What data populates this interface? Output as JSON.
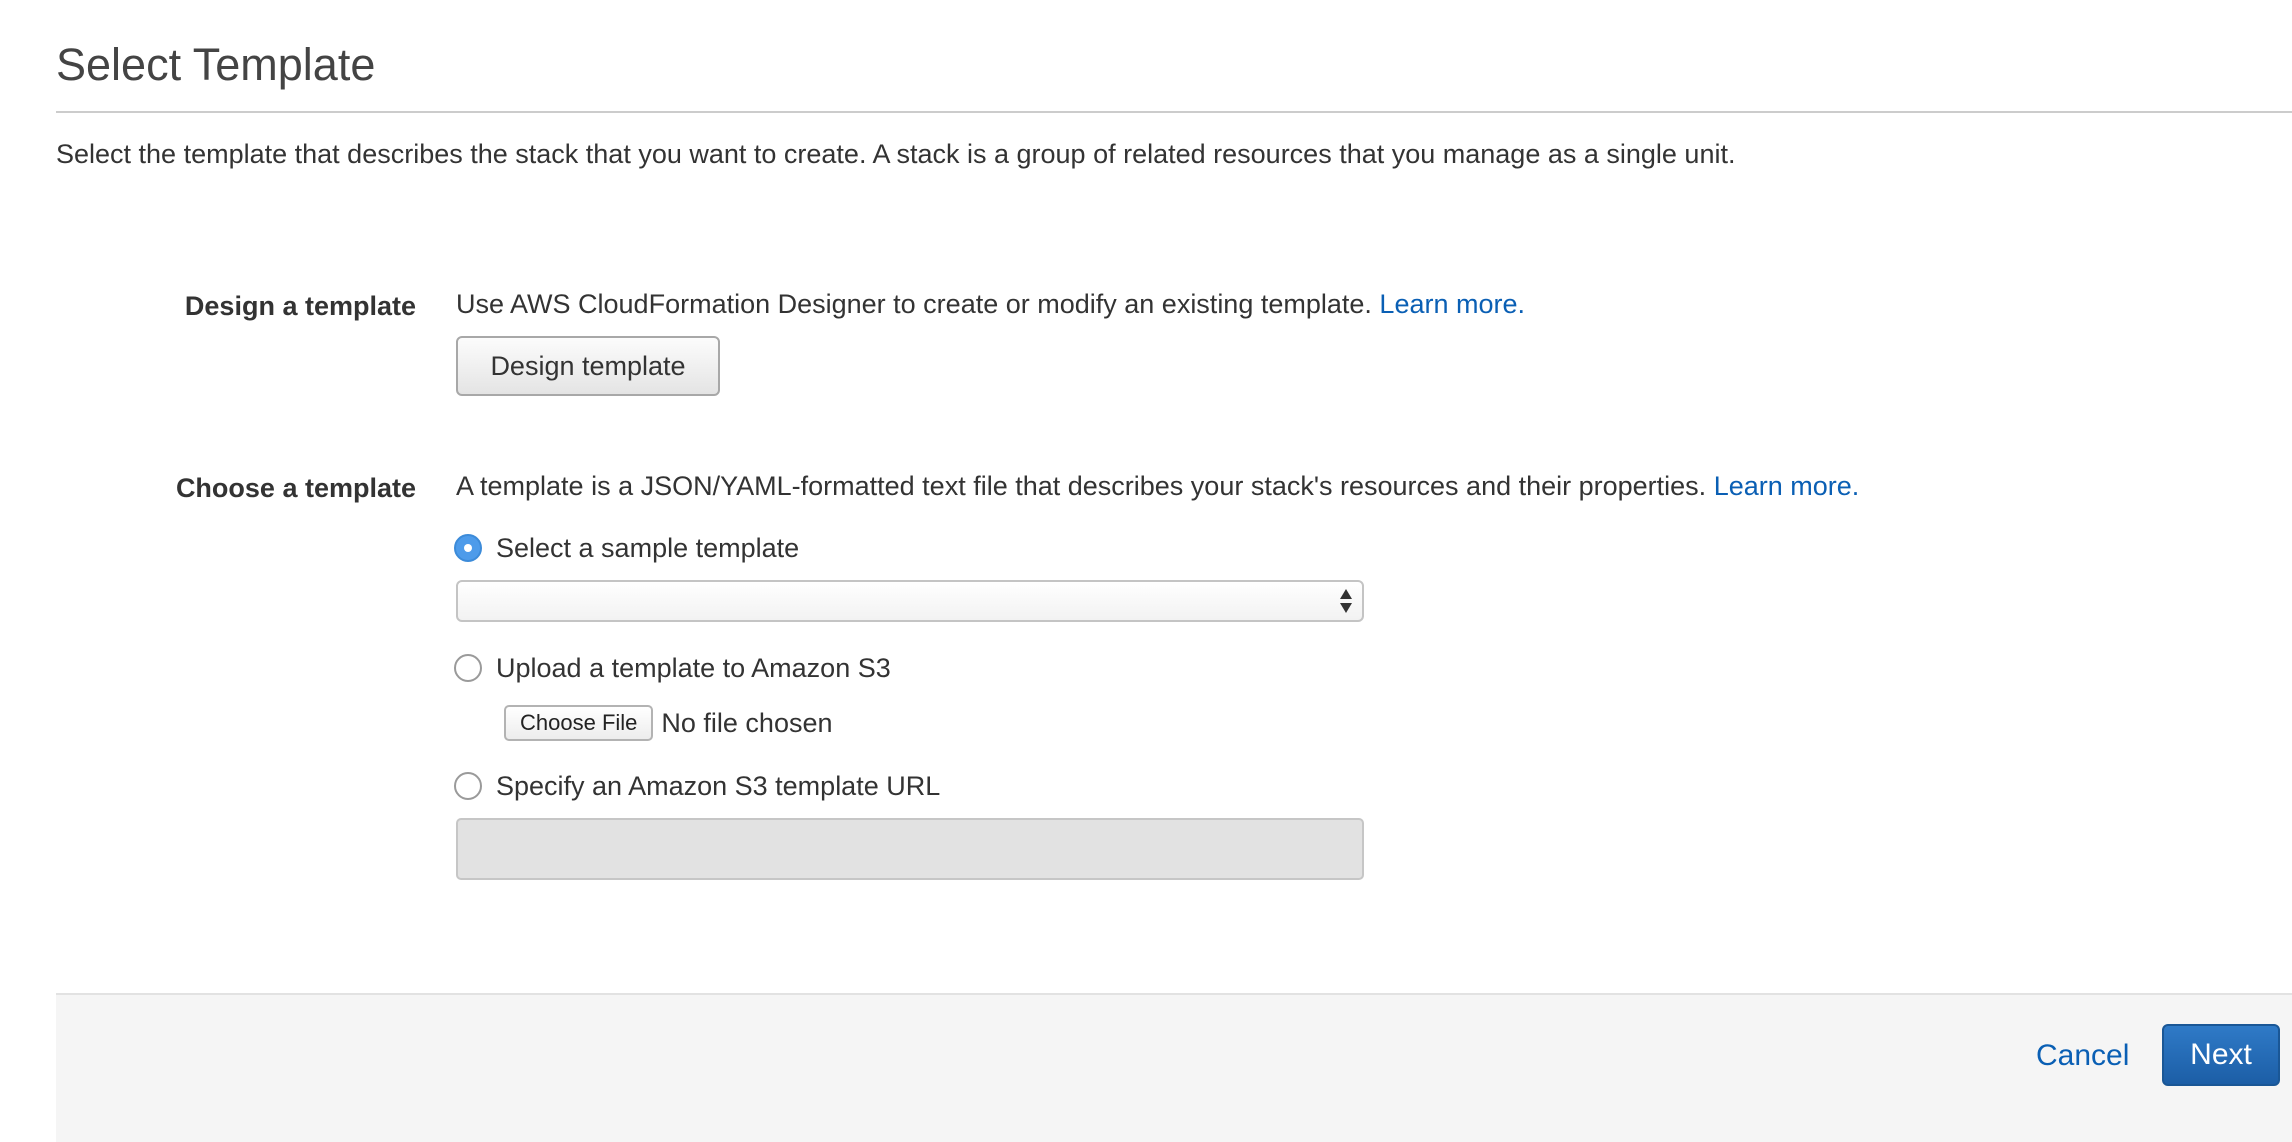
{
  "page": {
    "title": "Select Template",
    "intro": "Select the template that describes the stack that you want to create. A stack is a group of related resources that you manage as a single unit."
  },
  "design_section": {
    "label": "Design a template",
    "description": "Use AWS CloudFormation Designer to create or modify an existing template.",
    "learn_more": "Learn more.",
    "button_label": "Design template"
  },
  "choose_section": {
    "label": "Choose a template",
    "description": "A template is a JSON/YAML-formatted text file that describes your stack's resources and their properties.",
    "learn_more": "Learn more.",
    "options": [
      {
        "label": "Select a sample template",
        "checked": true
      },
      {
        "label": "Upload a template to Amazon S3",
        "checked": false
      },
      {
        "label": "Specify an Amazon S3 template URL",
        "checked": false
      }
    ],
    "sample_select_value": "",
    "file_button_label": "Choose File",
    "file_status": "No file chosen",
    "url_value": ""
  },
  "footer": {
    "cancel_label": "Cancel",
    "next_label": "Next"
  },
  "colors": {
    "link": "#0a5fb4",
    "primary_button": "#2f7ac7",
    "radio_selected": "#4d9bea",
    "footer_bg": "#f5f5f5"
  },
  "icons": {
    "select_arrows": "up-down-arrows-icon"
  }
}
